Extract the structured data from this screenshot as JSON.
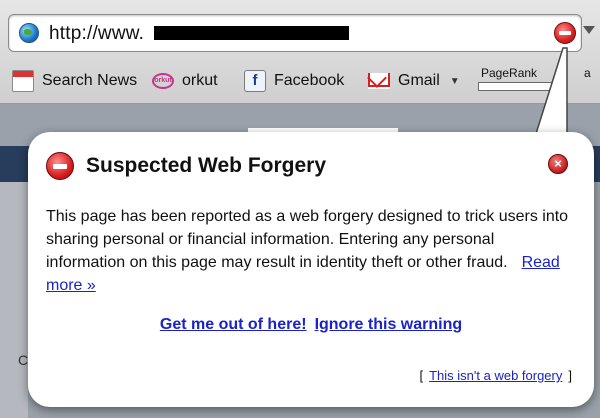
{
  "browser": {
    "url_visible": "http://www.",
    "bookmarks": [
      {
        "label": "Search News",
        "icon": "calendar-icon"
      },
      {
        "label": "orkut",
        "icon": "orkut-icon"
      },
      {
        "label": "Facebook",
        "icon": "facebook-icon"
      },
      {
        "label": "Gmail",
        "icon": "gmail-icon"
      }
    ],
    "orkut_logo_text": "orkut",
    "facebook_logo_text": "f",
    "pagerank_label": "PageRank",
    "cut_text": "a",
    "page_edge_letter": "C"
  },
  "warning": {
    "title": "Suspected Web Forgery",
    "body": "This page has been reported as a web forgery designed to trick users into sharing personal or financial information. Entering any personal information on this page may result in identity theft or other fraud.",
    "read_more": "Read more »",
    "get_out": "Get me out of here!",
    "ignore": "Ignore this warning",
    "bracket_open": "[",
    "not_forgery": "This isn't a web forgery",
    "bracket_close": "]",
    "close_glyph": "×"
  },
  "colors": {
    "link": "#1a23c8",
    "stop_red": "#d42020",
    "page_strip": "#273d5c"
  }
}
